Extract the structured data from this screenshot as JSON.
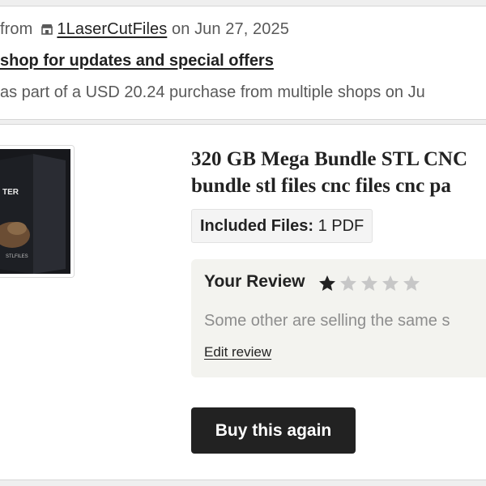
{
  "order": {
    "from_prefix": "from",
    "shop_name": "1LaserCutFiles",
    "date_text": "on Jun 27, 2025",
    "follow_shop_text": "shop for updates and special offers",
    "purchase_note": "as part of a USD 20.24 purchase from multiple shops on Ju"
  },
  "item": {
    "thumbnail_icon": "product-box-image",
    "thumbnail_text": "TER",
    "thumbnail_small_text": "STLFILES",
    "title_line1": "320 GB Mega Bundle STL CNC",
    "title_line2": "bundle stl files cnc files cnc pa",
    "included_label": "Included Files:",
    "included_value": "1 PDF"
  },
  "review": {
    "title": "Your Review",
    "rating": 1,
    "max_rating": 5,
    "star_filled_color": "#222222",
    "star_empty_color": "#c7c7c7",
    "text": "Some other are selling the same s",
    "edit_label": "Edit review"
  },
  "actions": {
    "buy_again_label": "Buy this again"
  }
}
